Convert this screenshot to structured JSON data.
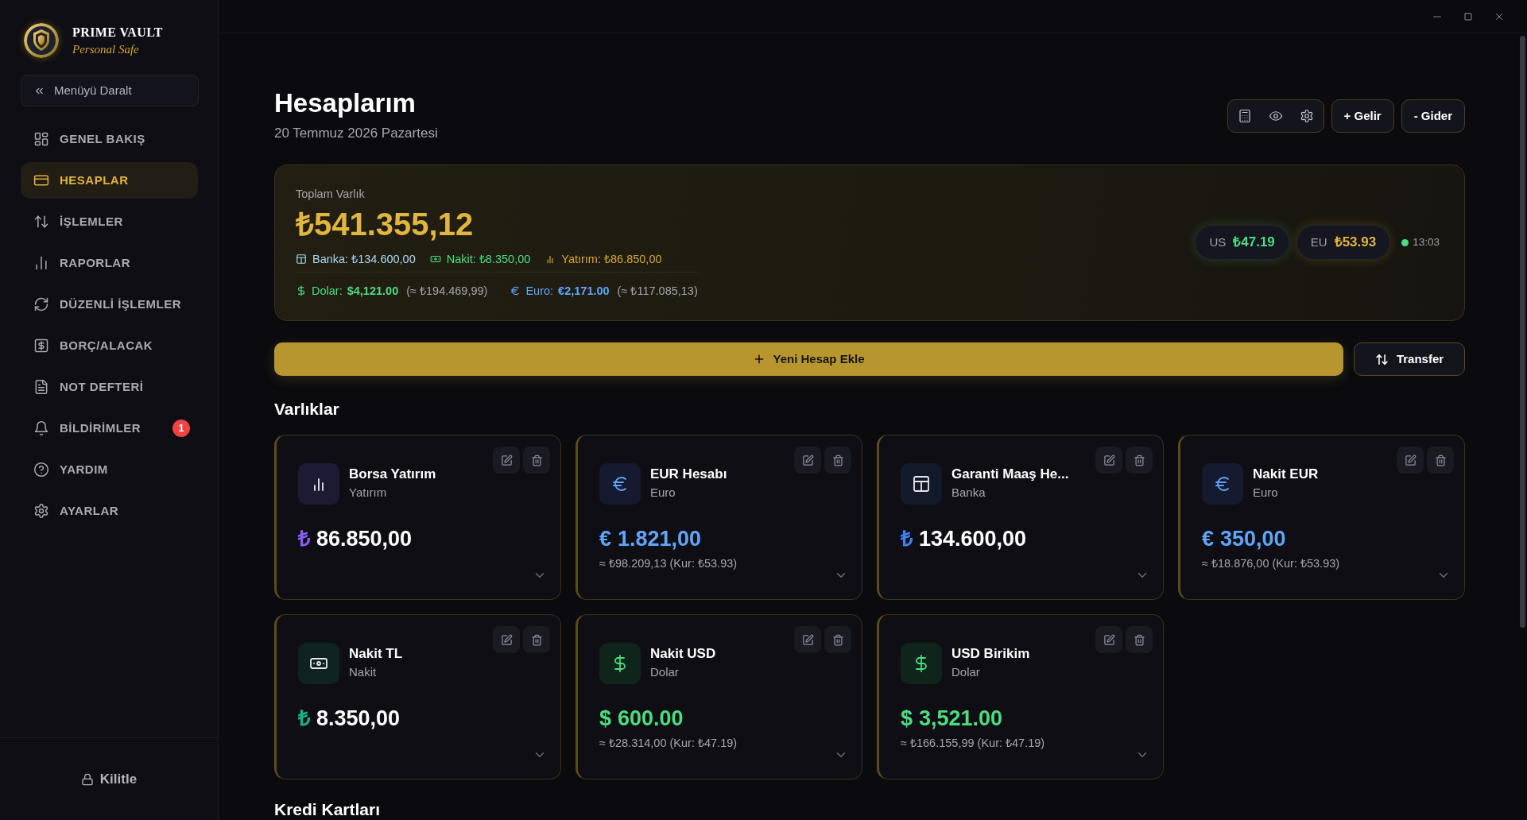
{
  "sidebar": {
    "brand": {
      "name": "PRIME VAULT",
      "tagline": "Personal Safe"
    },
    "collapse_button": "Menüyü Daralt",
    "items": [
      {
        "label": "GENEL BAKIŞ",
        "kind": "dashboard",
        "selected": false
      },
      {
        "label": "HESAPLAR",
        "kind": "card",
        "selected": true
      },
      {
        "label": "İŞLEMLER",
        "kind": "transfer",
        "selected": false
      },
      {
        "label": "RAPORLAR",
        "kind": "chart",
        "selected": false
      },
      {
        "label": "DÜZENLİ İŞLEMLER",
        "kind": "recurring",
        "selected": false
      },
      {
        "label": "BORÇ/ALACAK",
        "kind": "debt",
        "selected": false
      },
      {
        "label": "NOT DEFTERİ",
        "kind": "note",
        "selected": false
      },
      {
        "label": "BİLDİRİMLER",
        "kind": "bell",
        "selected": false,
        "badge": "1"
      },
      {
        "label": "YARDIM",
        "kind": "help",
        "selected": false
      },
      {
        "label": "AYARLAR",
        "kind": "settings",
        "selected": false
      }
    ],
    "lock_button": "Kilitle"
  },
  "header": {
    "title": "Hesaplarım",
    "date": "20 Temmuz 2026 Pazartesi",
    "buttons": [
      "+ Gelir",
      "- Gider"
    ]
  },
  "summary": {
    "label": "Toplam Varlık",
    "total": "₺541.355,12",
    "breakdown": [
      {
        "kind": "bank",
        "text": "Banka: ₺134.600,00",
        "color": "#a9d8ef"
      },
      {
        "kind": "cash",
        "text": "Nakit: ₺8.350,00",
        "color": "#4ade80"
      },
      {
        "kind": "investment",
        "text": "Yatırım: ₺86.850,00",
        "color": "#d4a72c"
      }
    ],
    "currencies": [
      {
        "kind": "dollar",
        "label": "Dolar:",
        "value": "$4,121.00",
        "approx": "(≈ ₺194.469,99)",
        "color": "#4ade80"
      },
      {
        "kind": "euro",
        "label": "Euro:",
        "value": "€2,171.00",
        "approx": "(≈ ₺117.085,13)",
        "color": "#60a5fa"
      }
    ],
    "rates": [
      {
        "code": "US",
        "value": "₺47.19",
        "color": "#4ade80"
      },
      {
        "code": "EU",
        "value": "₺53.93",
        "color": "#e2b53e"
      }
    ],
    "updated": "13:03"
  },
  "actions": {
    "add_account": "Yeni Hesap Ekle",
    "transfer": "Transfer"
  },
  "assets": {
    "title": "Varlıklar",
    "accounts": [
      {
        "name": "Borsa Yatırım",
        "type": "Yatırım",
        "kind": "investment",
        "color": "#8b5cf6",
        "symbol": "₺",
        "balance": "86.850,00",
        "expanded": false
      },
      {
        "name": "EUR Hesabı",
        "type": "Euro",
        "kind": "euro",
        "color": "#60a5fa",
        "symbol": "€",
        "balance": "1.821,00",
        "conversion": "≈ ₺98.209,13 (Kur: ₺53.93)",
        "expanded": false
      },
      {
        "name": "Garanti Maaş He...",
        "type": "Banka",
        "kind": "bank",
        "color": "#3b82f6",
        "symbol": "₺",
        "balance": "134.600,00",
        "expanded": false
      },
      {
        "name": "Nakit EUR",
        "type": "Euro",
        "kind": "euro",
        "color": "#60a5fa",
        "symbol": "€",
        "balance": "350,00",
        "conversion": "≈ ₺18.876,00 (Kur: ₺53.93)",
        "expanded": false
      },
      {
        "name": "Nakit TL",
        "type": "Nakit",
        "kind": "cash",
        "color": "#10b981",
        "symbol": "₺",
        "balance": "8.350,00",
        "expanded": false
      },
      {
        "name": "Nakit USD",
        "type": "Dolar",
        "kind": "dollar",
        "color": "#4ade80",
        "symbol": "$",
        "balance": "600.00",
        "conversion": "≈ ₺28.314,00 (Kur: ₺47.19)",
        "expanded": false
      },
      {
        "name": "USD Birikim",
        "type": "Dolar",
        "kind": "dollar",
        "color": "#4ade80",
        "symbol": "$",
        "balance": "3,521.00",
        "conversion": "≈ ₺166.155,99 (Kur: ₺47.19)",
        "expanded": false
      }
    ]
  },
  "credit_cards": {
    "title": "Kredi Kartları"
  }
}
